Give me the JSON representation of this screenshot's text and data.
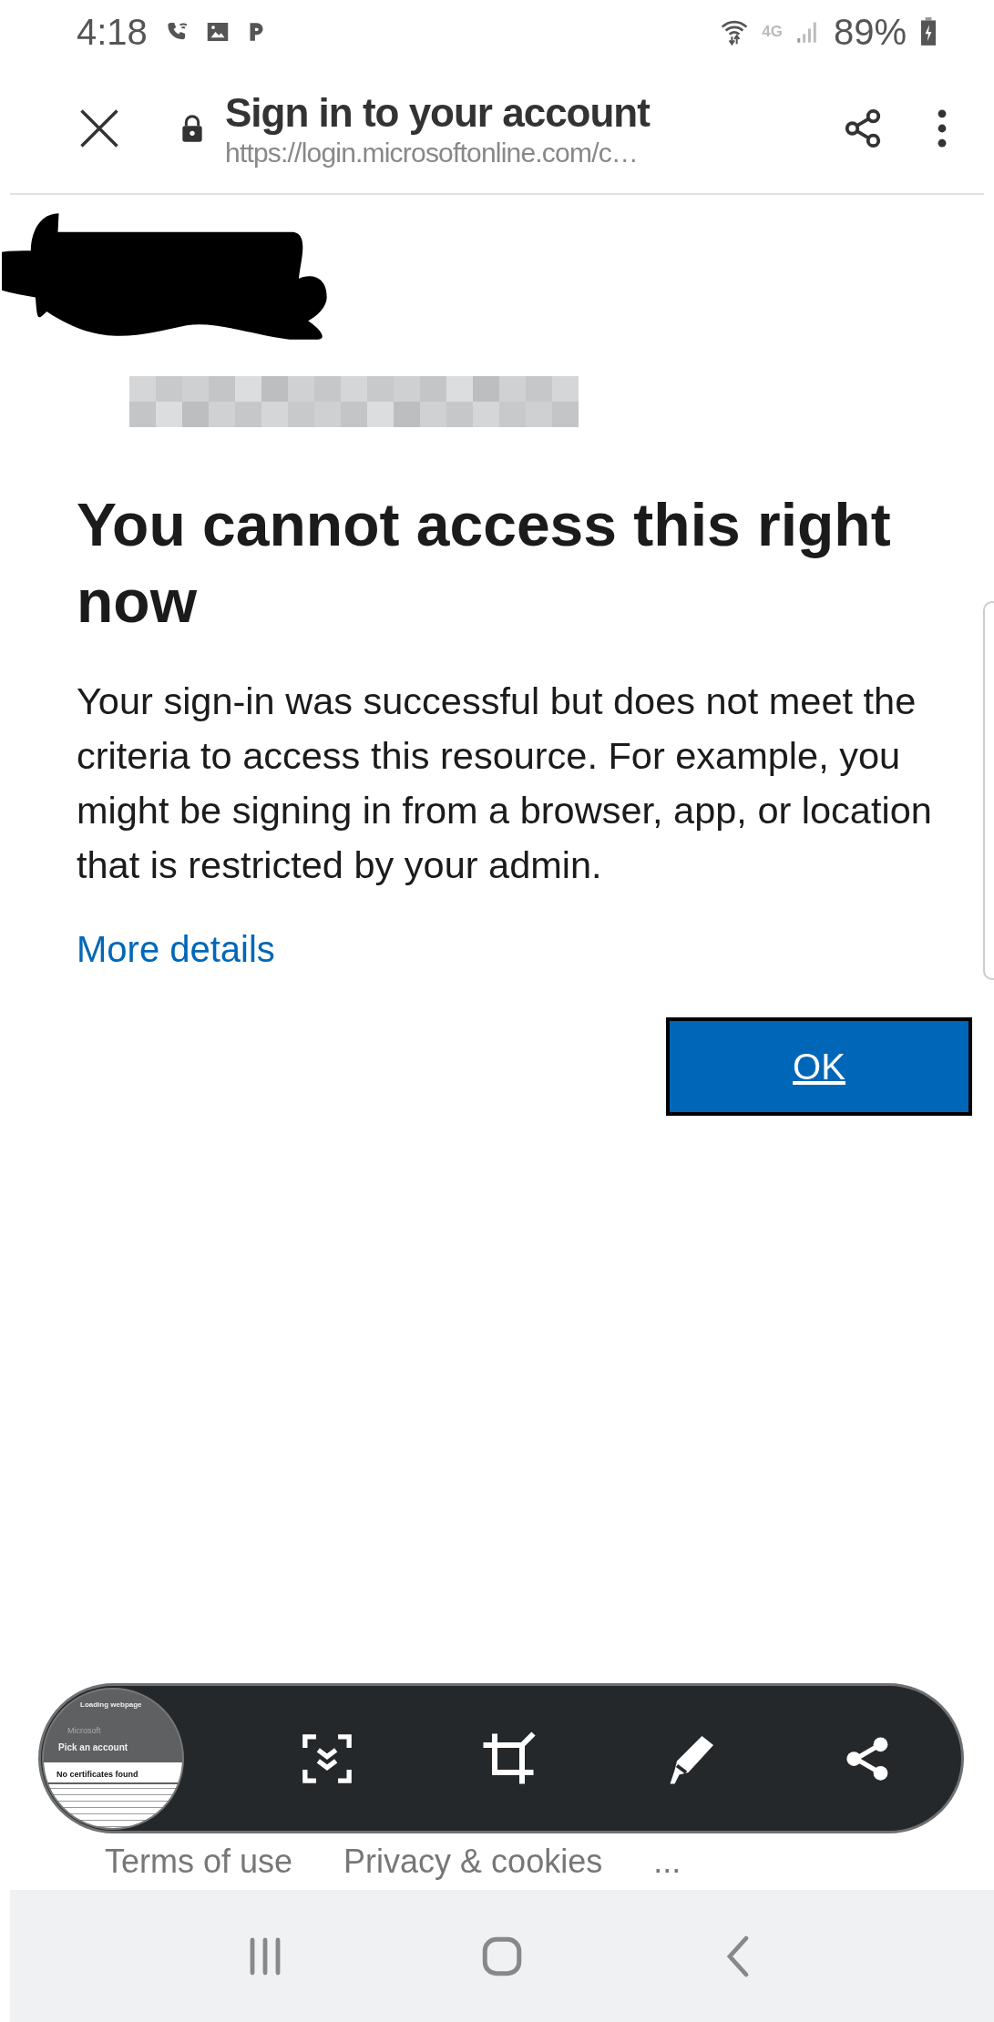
{
  "status_bar": {
    "time": "4:18",
    "network": "4G",
    "battery": "89%"
  },
  "browser_bar": {
    "title": "Sign in to your account",
    "url": "https://login.microsoftonline.com/c…"
  },
  "page": {
    "heading": "You cannot access this right now",
    "message": "Your sign-in was successful but does not meet the criteria to access this resource. For example, you might be signing in from a browser, app, or location that is restricted by your admin.",
    "link": "More details",
    "button": "OK"
  },
  "footer": {
    "links": [
      "Terms of use",
      "Privacy & cookies",
      "..."
    ]
  },
  "screenshot_toolbar": {
    "thumbnail": {
      "lines": [
        "Loading webpage",
        "Microsoft",
        "Pick an account",
        "No certificates found"
      ]
    }
  }
}
